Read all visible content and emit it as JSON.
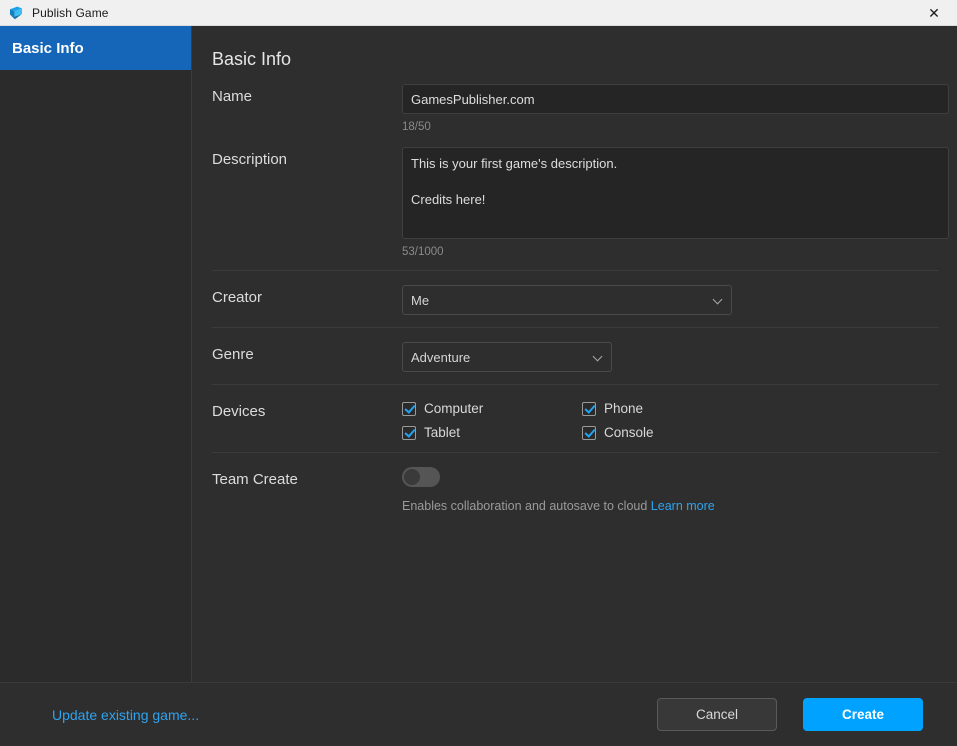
{
  "window": {
    "title": "Publish Game",
    "icon": "studio-icon",
    "close_label": "✕"
  },
  "sidebar": {
    "items": [
      {
        "label": "Basic Info",
        "active": true
      }
    ]
  },
  "main": {
    "title": "Basic Info",
    "name": {
      "label": "Name",
      "value": "GamesPublisher.com",
      "placeholder": "Name",
      "counter": "18/50"
    },
    "description": {
      "label": "Description",
      "value": "This is your first game's description.\n\nCredits here!",
      "placeholder": "Description",
      "counter": "53/1000"
    },
    "creator": {
      "label": "Creator",
      "value": "Me",
      "chevron": "chevron-down-icon"
    },
    "genre": {
      "label": "Genre",
      "value": "Adventure",
      "chevron": "chevron-down-icon"
    },
    "devices": {
      "label": "Devices",
      "items": [
        {
          "label": "Computer",
          "checked": true
        },
        {
          "label": "Phone",
          "checked": true
        },
        {
          "label": "Tablet",
          "checked": true
        },
        {
          "label": "Console",
          "checked": true
        }
      ]
    },
    "team_create": {
      "label": "Team Create",
      "enabled": false,
      "helper_text": "Enables collaboration and autosave to cloud",
      "learn_more": "Learn more"
    }
  },
  "footer": {
    "update_link": "Update existing game...",
    "cancel_label": "Cancel",
    "create_label": "Create"
  },
  "colors": {
    "accent_blue": "#00a2ff",
    "sidebar_active": "#1565b8",
    "link_blue": "#2fa3f0",
    "checkbox_blue": "#20a4f3",
    "titlebar_bg": "#f0f0f0",
    "content_bg": "#2e2e2e",
    "sidebar_bg": "#2b2b2b"
  }
}
